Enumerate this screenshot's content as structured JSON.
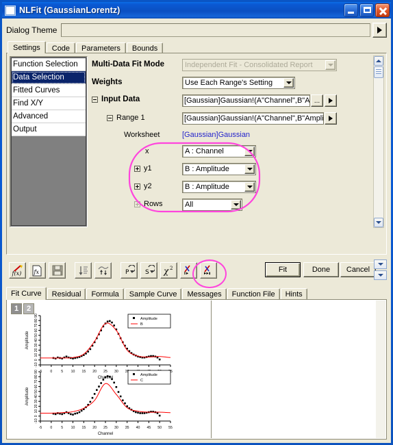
{
  "window": {
    "title": "NLFit (GaussianLorentz)",
    "buttons": {
      "minimize": "minimize",
      "maximize": "maximize",
      "close": "close"
    }
  },
  "theme": {
    "label": "Dialog Theme",
    "value": "",
    "placeholder": "",
    "expand_button": "expand-theme"
  },
  "top_tabs": [
    {
      "label": "Settings",
      "selected": true
    },
    {
      "label": "Code",
      "selected": false
    },
    {
      "label": "Parameters",
      "selected": false
    },
    {
      "label": "Bounds",
      "selected": false
    }
  ],
  "tree": [
    {
      "label": "Function Selection",
      "selected": false
    },
    {
      "label": "Data Selection",
      "selected": true
    },
    {
      "label": "Fitted Curves",
      "selected": false
    },
    {
      "label": "Find X/Y",
      "selected": false
    },
    {
      "label": "Advanced",
      "selected": false
    },
    {
      "label": "Output",
      "selected": false
    }
  ],
  "settings": {
    "multi_data_fit_mode": {
      "label": "Multi-Data Fit Mode",
      "value": "Independent Fit - Consolidated Report",
      "disabled": true
    },
    "weights": {
      "label": "Weights",
      "value": "Use Each Range's Setting"
    },
    "input_data": {
      "label": "Input Data",
      "value": "[Gaussian]Gaussian!(A\"Channel\",B\"Amplitude\"",
      "browse_label": "...",
      "expand_label": "▶"
    },
    "range1": {
      "label": "Range 1",
      "value": "[Gaussian]Gaussian!(A\"Channel\",B\"Amplitude\"",
      "expand_label": "▶"
    },
    "worksheet": {
      "label": "Worksheet",
      "value": "[Gaussian]Gaussian"
    },
    "x": {
      "label": "x",
      "value": "A : Channel"
    },
    "y1": {
      "label": "y1",
      "value": "B : Amplitude"
    },
    "y2": {
      "label": "y2",
      "value": "B : Amplitude"
    },
    "rows": {
      "label": "Rows",
      "value": "All"
    }
  },
  "toolbar": {
    "icons": [
      {
        "name": "new-function-icon",
        "glyph": "f(x)"
      },
      {
        "name": "import-function-file-icon",
        "glyph": "f(x)"
      },
      {
        "name": "save-icon",
        "glyph": "save"
      },
      {
        "name": "initialize-parameters-icon",
        "glyph": "down-arrow-lines"
      },
      {
        "name": "auto-parameter-icon",
        "glyph": "up-arrows"
      },
      {
        "name": "undo-p-icon",
        "glyph": "P"
      },
      {
        "name": "undo-s-icon",
        "glyph": "S"
      },
      {
        "name": "chi-square-icon",
        "glyph": "χ²"
      },
      {
        "name": "one-iteration-icon",
        "glyph": "step"
      },
      {
        "name": "fit-until-converged-icon",
        "glyph": "run"
      }
    ],
    "fit_label": "Fit",
    "done_label": "Done",
    "cancel_label": "Cancel",
    "nav_up": "▼",
    "nav_down": "▼"
  },
  "bottom_tabs": [
    {
      "label": "Fit Curve",
      "selected": true
    },
    {
      "label": "Residual",
      "selected": false
    },
    {
      "label": "Formula",
      "selected": false
    },
    {
      "label": "Sample Curve",
      "selected": false
    },
    {
      "label": "Messages",
      "selected": false
    },
    {
      "label": "Function File",
      "selected": false
    },
    {
      "label": "Hints",
      "selected": false
    }
  ],
  "page_tabs": [
    {
      "label": "1",
      "selected": true
    },
    {
      "label": "2",
      "selected": false
    }
  ],
  "chart_data": [
    {
      "type": "scatter",
      "title": "",
      "xlabel": "Channel",
      "ylabel": "Amplitude",
      "xlim": [
        -5,
        55
      ],
      "ylim": [
        -10,
        90
      ],
      "xticks": [
        -5,
        0,
        5,
        10,
        15,
        20,
        25,
        30,
        35,
        40,
        45,
        50,
        55
      ],
      "yticks": [
        -10,
        0,
        10,
        20,
        30,
        40,
        50,
        60,
        70,
        80,
        90
      ],
      "grid": false,
      "legend_position": "top-right",
      "series": [
        {
          "name": "Amplitude",
          "type": "scatter",
          "marker": "square",
          "color": "#000000",
          "x": [
            1,
            2,
            3,
            4,
            5,
            6,
            7,
            8,
            9,
            10,
            11,
            12,
            13,
            14,
            15,
            16,
            17,
            18,
            19,
            20,
            21,
            22,
            23,
            24,
            25,
            26,
            27,
            28,
            29,
            30,
            31,
            32,
            33,
            34,
            35,
            36,
            37,
            38,
            39,
            40,
            41,
            42,
            43,
            44,
            45,
            46,
            47,
            48,
            49,
            50
          ],
          "y": [
            4,
            3,
            5,
            4,
            3,
            5,
            7,
            5,
            4,
            3,
            4,
            5,
            6,
            8,
            10,
            13,
            17,
            22,
            29,
            36,
            44,
            52,
            60,
            68,
            74,
            78,
            79,
            76,
            70,
            62,
            53,
            44,
            36,
            29,
            23,
            18,
            14,
            11,
            9,
            7,
            6,
            5,
            5,
            6,
            7,
            8,
            8,
            7,
            5,
            1
          ]
        },
        {
          "name": "B",
          "type": "line",
          "color": "#ff0000",
          "x": [
            -5,
            0,
            5,
            10,
            15,
            20,
            25,
            30,
            35,
            40,
            45,
            50,
            55
          ],
          "y": [
            4,
            4,
            4,
            5,
            12,
            38,
            74,
            60,
            20,
            8,
            6,
            7,
            5
          ]
        }
      ]
    },
    {
      "type": "scatter",
      "title": "",
      "xlabel": "Channel",
      "ylabel": "Amplitude",
      "xlim": [
        -5,
        55
      ],
      "ylim": [
        -10,
        90
      ],
      "xticks": [
        -5,
        0,
        5,
        10,
        15,
        20,
        25,
        30,
        35,
        40,
        45,
        50,
        55
      ],
      "yticks": [
        -10,
        0,
        10,
        20,
        30,
        40,
        50,
        60,
        70,
        80,
        90
      ],
      "grid": false,
      "legend_position": "top-right",
      "series": [
        {
          "name": "Amplitude",
          "type": "scatter",
          "marker": "square",
          "color": "#000000",
          "x": [
            1,
            2,
            3,
            4,
            5,
            6,
            7,
            8,
            9,
            10,
            11,
            12,
            13,
            14,
            15,
            16,
            17,
            18,
            19,
            20,
            21,
            22,
            23,
            24,
            25,
            26,
            27,
            28,
            29,
            30,
            31,
            32,
            33,
            34,
            35,
            36,
            37,
            38,
            39,
            40,
            41,
            42,
            43,
            44,
            45,
            46,
            47,
            48,
            49,
            50
          ],
          "y": [
            5,
            4,
            6,
            5,
            4,
            6,
            8,
            6,
            4,
            3,
            5,
            6,
            8,
            11,
            14,
            18,
            23,
            29,
            37,
            45,
            53,
            60,
            67,
            74,
            79,
            81,
            80,
            75,
            68,
            59,
            49,
            40,
            32,
            26,
            20,
            16,
            13,
            10,
            8,
            7,
            6,
            6,
            6,
            7,
            8,
            9,
            9,
            8,
            6,
            1
          ]
        },
        {
          "name": "C",
          "type": "line",
          "color": "#ff0000",
          "x": [
            -5,
            0,
            5,
            10,
            15,
            20,
            25,
            30,
            35,
            40,
            45,
            50,
            55
          ],
          "y": [
            6,
            6,
            7,
            9,
            16,
            32,
            66,
            44,
            17,
            10,
            8,
            8,
            7
          ]
        }
      ]
    }
  ],
  "highlights": [
    {
      "name": "xy-selection-highlight"
    },
    {
      "name": "fit-converge-button-highlight"
    }
  ]
}
